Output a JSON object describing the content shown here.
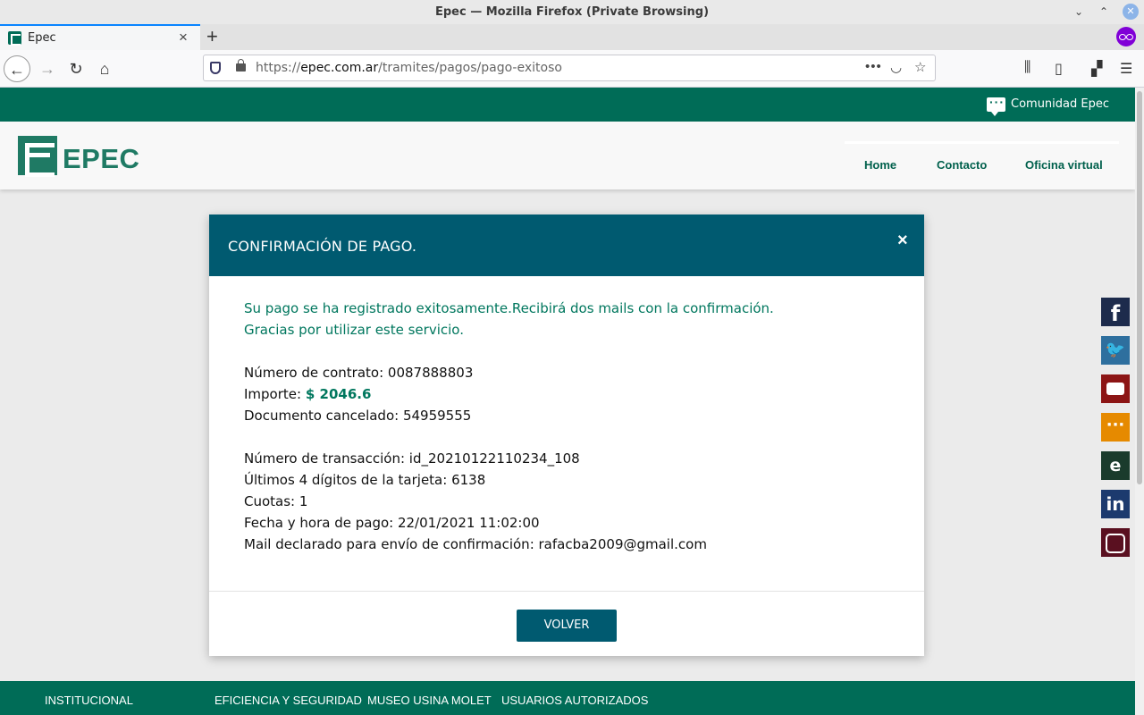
{
  "window": {
    "title": "Epec — Mozilla Firefox (Private Browsing)"
  },
  "tab": {
    "label": "Epec"
  },
  "urlbar": {
    "scheme": "https://",
    "host": "epec.com.ar",
    "path": "/tramites/pagos/pago-exitoso"
  },
  "site": {
    "community_label": "Comunidad Epec",
    "logo_text": "EPEC",
    "nav": {
      "home": "Home",
      "contacto": "Contacto",
      "oficina": "Oficina virtual"
    }
  },
  "modal": {
    "title": "CONFIRMACIÓN DE PAGO.",
    "close": "×",
    "message_line1": "Su pago se ha registrado exitosamente.Recibirá dos mails con la confirmación.",
    "message_line2": "Gracias por utilizar este servicio.",
    "contract_label": "Número de contrato: ",
    "contract_value": "0087888803",
    "amount_label": "Importe: ",
    "amount_value": "$ 2046.6",
    "document_label": "Documento cancelado: ",
    "document_value": "54959555",
    "transaction_label": "Número de transacción: ",
    "transaction_value": "id_20210122110234_108",
    "card_label": "Últimos 4 dígitos de la tarjeta: ",
    "card_value": "6138",
    "installments_label": "Cuotas: ",
    "installments_value": "1",
    "date_label": "Fecha y hora de pago: ",
    "date_value": "22/01/2021 11:02:00",
    "mail_label": "Mail declarado para envío de confirmación: ",
    "mail_value": "rafacba2009@gmail.com",
    "button": "VOLVER"
  },
  "social": {
    "facebook": "f",
    "twitter": "🐦",
    "youtube": "",
    "chat": "···",
    "epec": "e",
    "linkedin": "in",
    "instagram": ""
  },
  "footer": {
    "links": [
      "INSTITUCIONAL",
      "EFICIENCIA Y SEGURIDAD",
      "MUSEO USINA MOLET",
      "USUARIOS AUTORIZADOS"
    ]
  },
  "colors": {
    "brand_green": "#006c57",
    "modal_header": "#005a70",
    "success_text": "#00775e"
  }
}
